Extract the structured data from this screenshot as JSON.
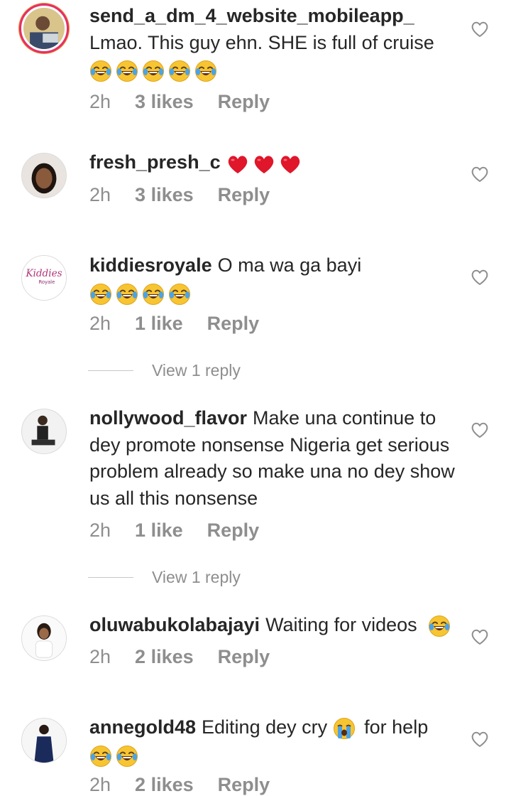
{
  "comments": [
    {
      "username": "send_a_dm_4_website_mobileapp_",
      "text": "Lmao.  This guy ehn. SHE is full of cruise",
      "emojis": [
        "😂",
        "😂",
        "😂",
        "😂",
        "😂"
      ],
      "time": "2h",
      "likes": "3 likes",
      "reply": "Reply"
    },
    {
      "username": "fresh_presh_c",
      "text": "",
      "emojis": [
        "❤️",
        "❤️",
        "❤️"
      ],
      "time": "2h",
      "likes": "3 likes",
      "reply": "Reply"
    },
    {
      "username": "kiddiesroyale",
      "text": "O ma wa ga bayi",
      "emojis": [
        "😂",
        "😂",
        "😂",
        "😂"
      ],
      "time": "2h",
      "likes": "1 like",
      "reply": "Reply",
      "view_replies": "View 1 reply"
    },
    {
      "username": "nollywood_flavor",
      "text": "Make una continue to dey promote nonsense Nigeria get serious problem already so make una no dey show us all this nonsense",
      "time": "2h",
      "likes": "1 like",
      "reply": "Reply",
      "view_replies": "View 1 reply"
    },
    {
      "username": "oluwabukolabajayi",
      "text": "Waiting for videos",
      "emojis": [
        "😂"
      ],
      "time": "2h",
      "likes": "2 likes",
      "reply": "Reply"
    },
    {
      "username": "annegold48",
      "text_before": "Editing dey cry",
      "text_emoji": "😭",
      "text_after": "for help",
      "emojis": [
        "😂",
        "😂"
      ],
      "time": "2h",
      "likes": "2 likes",
      "reply": "Reply"
    }
  ],
  "colors": {
    "username": "#262626",
    "meta": "#8e8e8e",
    "background": "#ffffff",
    "emoji_face": "#f7c531"
  }
}
